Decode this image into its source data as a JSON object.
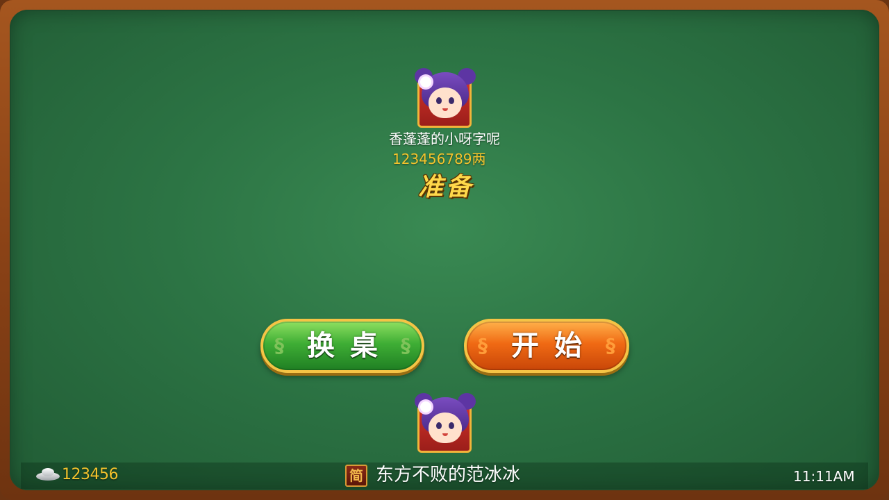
{
  "top_player": {
    "name": "香蓬蓬的小呀字呢",
    "gold": "123456789两",
    "status": "准备",
    "avatar_icon": "girl-avatar-icon"
  },
  "buttons": {
    "change_table": "换桌",
    "start": "开始"
  },
  "self_player": {
    "avatar_icon": "girl-avatar-icon",
    "silver_icon": "silver-ingot-icon",
    "silver": "123456",
    "lang_badge": "简",
    "name": "东方不败的范冰冰"
  },
  "status_bar": {
    "time": "11:11AM"
  },
  "colors": {
    "felt": "#2c7444",
    "frame": "#8a4216",
    "gold_text": "#f4c32c",
    "green_button": "#3fae35",
    "orange_button": "#f06a14"
  }
}
